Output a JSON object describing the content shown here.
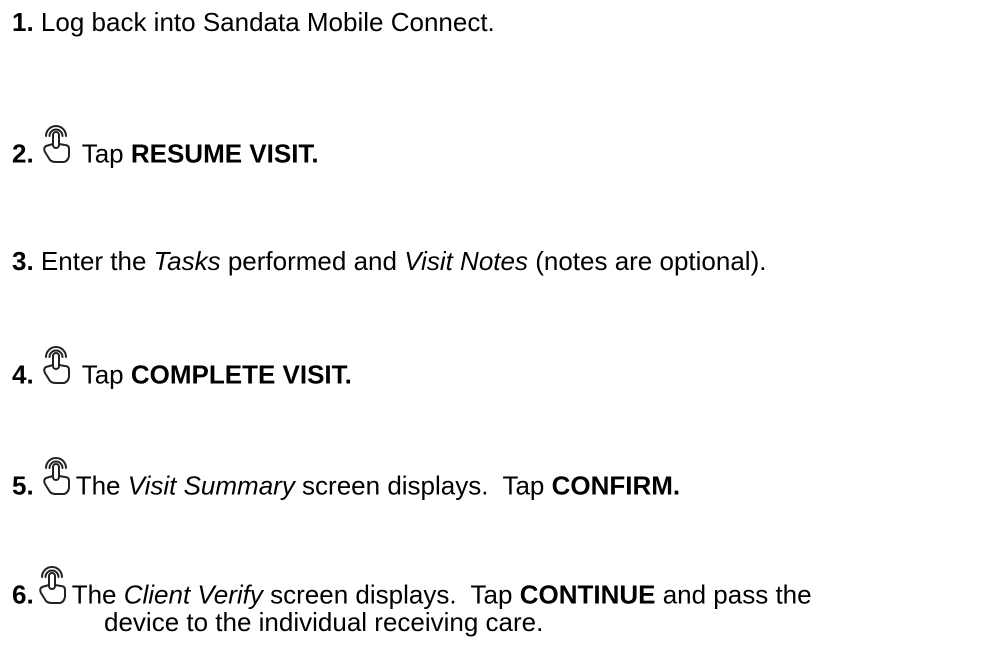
{
  "steps": [
    {
      "num": "1.",
      "parts": [
        "Log back into Sandata Mobile Connect."
      ]
    },
    {
      "num": "2.",
      "icon": "tap-gesture-icon",
      "parts": [
        "Tap ",
        "RESUME VISIT."
      ]
    },
    {
      "num": "3.",
      "parts": [
        "Enter the ",
        "Tasks",
        " performed and ",
        "Visit Notes",
        " (notes are optional)."
      ]
    },
    {
      "num": "4.",
      "icon": "tap-gesture-icon",
      "parts": [
        "Tap ",
        "COMPLETE VISIT."
      ]
    },
    {
      "num": "5.",
      "icon": "tap-gesture-icon",
      "parts": [
        "The ",
        "Visit Summary",
        " screen displays.  Tap ",
        "CONFIRM."
      ]
    },
    {
      "num": "6.",
      "icon": "tap-gesture-icon",
      "parts": [
        "The ",
        "Client Verify",
        " screen displays.  Tap ",
        "CONTINUE",
        " and pass the"
      ],
      "continuation": "device to the individual receiving care."
    }
  ]
}
